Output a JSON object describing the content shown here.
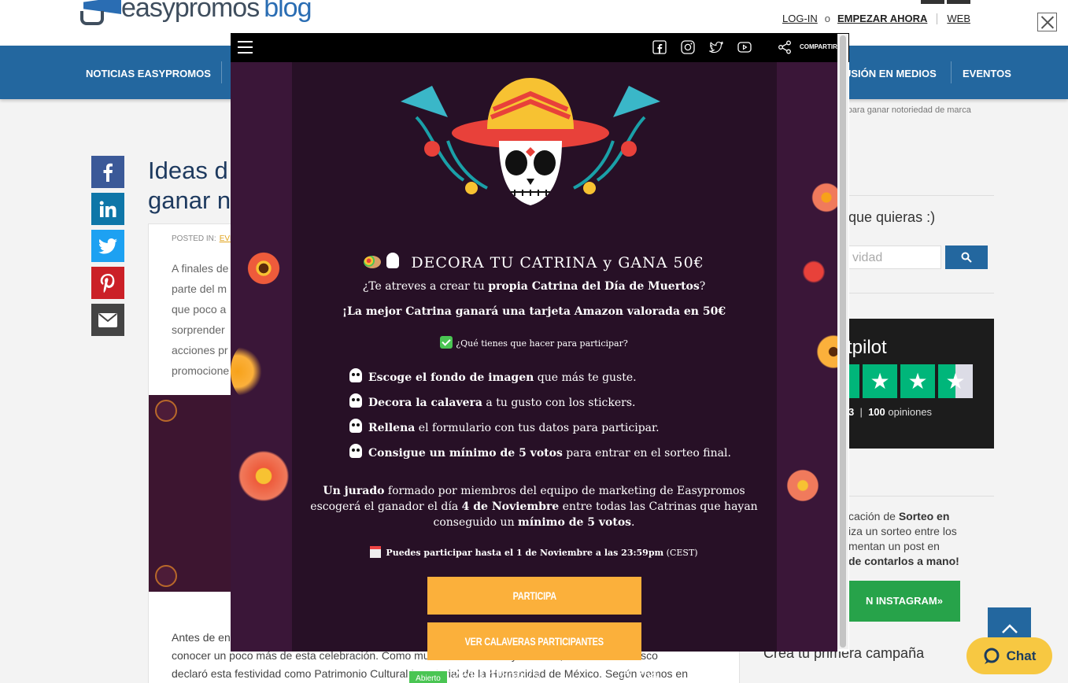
{
  "header": {
    "logo_text": "easypromos",
    "logo_suffix": "blog",
    "login_label": "LOG-IN",
    "or_label": "o",
    "start_label": "EMPEZAR AHORA",
    "web_label": "WEB"
  },
  "nav": {
    "items": [
      "NOTICIAS EASYPROMOS",
      "USIÓN EN MEDIOS",
      "EVENTOS"
    ]
  },
  "breadcrumb": "os para ganar notoriedad de marca",
  "article": {
    "title": "Ideas d\nganar n",
    "posted_label": "POSTED IN:",
    "category": "EVE",
    "excerpt": "A finales de\nparte del m\nque poco a\nsorprender\nacciones pr\npromocione",
    "body": "Antes de en                                                                                                    rsona\nconocer un poco más de esta celebración. Como muchos mexicanos ya sabrán, en 2008 la Unesco\ndeclaró esta festividad como Patrimonio Cultural Inmaterial de la Humanidad de México. Según vemos en"
  },
  "sidebar": {
    "search_text": "que quieras :)",
    "search_placeholder": "vidad",
    "trustpilot_title": "stpilot",
    "trustpilot_rating": "3",
    "trustpilot_count": "100",
    "trustpilot_reviews_label": "opiniones",
    "promo_1": "cación de ",
    "promo_1b": "Sorteo en",
    "promo_2": "iza un sorteo entre los",
    "promo_3": "mentan un post en",
    "promo_4b": "de contarlos a mano!",
    "insta_button": "N INSTAGRAM»",
    "campaign_title": "Crea tu primera campaña",
    "chat_label": "Chat"
  },
  "modal": {
    "share_label": "COMPARTIR",
    "heading": "DECORA TU CATRINA y GANA 50€",
    "line1_pre": "¿Te atreves a crear tu ",
    "line1_bold": "propia Catrina del Día de Muertos",
    "line1_post": "?",
    "line2": "¡La mejor Catrina ganará una tarjeta Amazon valorada en 50€",
    "check_question": "¿Qué tienes que hacer para participar?",
    "steps": [
      {
        "bold": "Escoge el fondo de imagen",
        "rest": " que más te guste."
      },
      {
        "bold": "Decora la calavera",
        "rest": " a tu gusto con los stickers."
      },
      {
        "bold": "Rellena",
        "rest": " el formulario con tus datos para participar."
      },
      {
        "bold": "Consigue un mínimo de 5 votos",
        "rest": " para entrar en el sorteo final."
      }
    ],
    "para_b1": "Un jurado",
    "para_t1": " formado por miembros del equipo de marketing de Easypromos escogerá el ganador el día ",
    "para_b2": "4 de Noviembre",
    "para_t2": " entre todas las Catrinas que hayan conseguido un ",
    "para_b3": "mínimo de 5 votos",
    "para_t3": ".",
    "deadline_bold": "Puedes participar hasta el 1 de Noviembre a las 23:59pm",
    "deadline_tz": " (CEST)",
    "participate_button": "PARTICIPA",
    "view_button": "VER CALAVERAS PARTICIPANTES",
    "status_label": "Abierto",
    "countdown": "22d10h18m37s",
    "views": "754"
  }
}
